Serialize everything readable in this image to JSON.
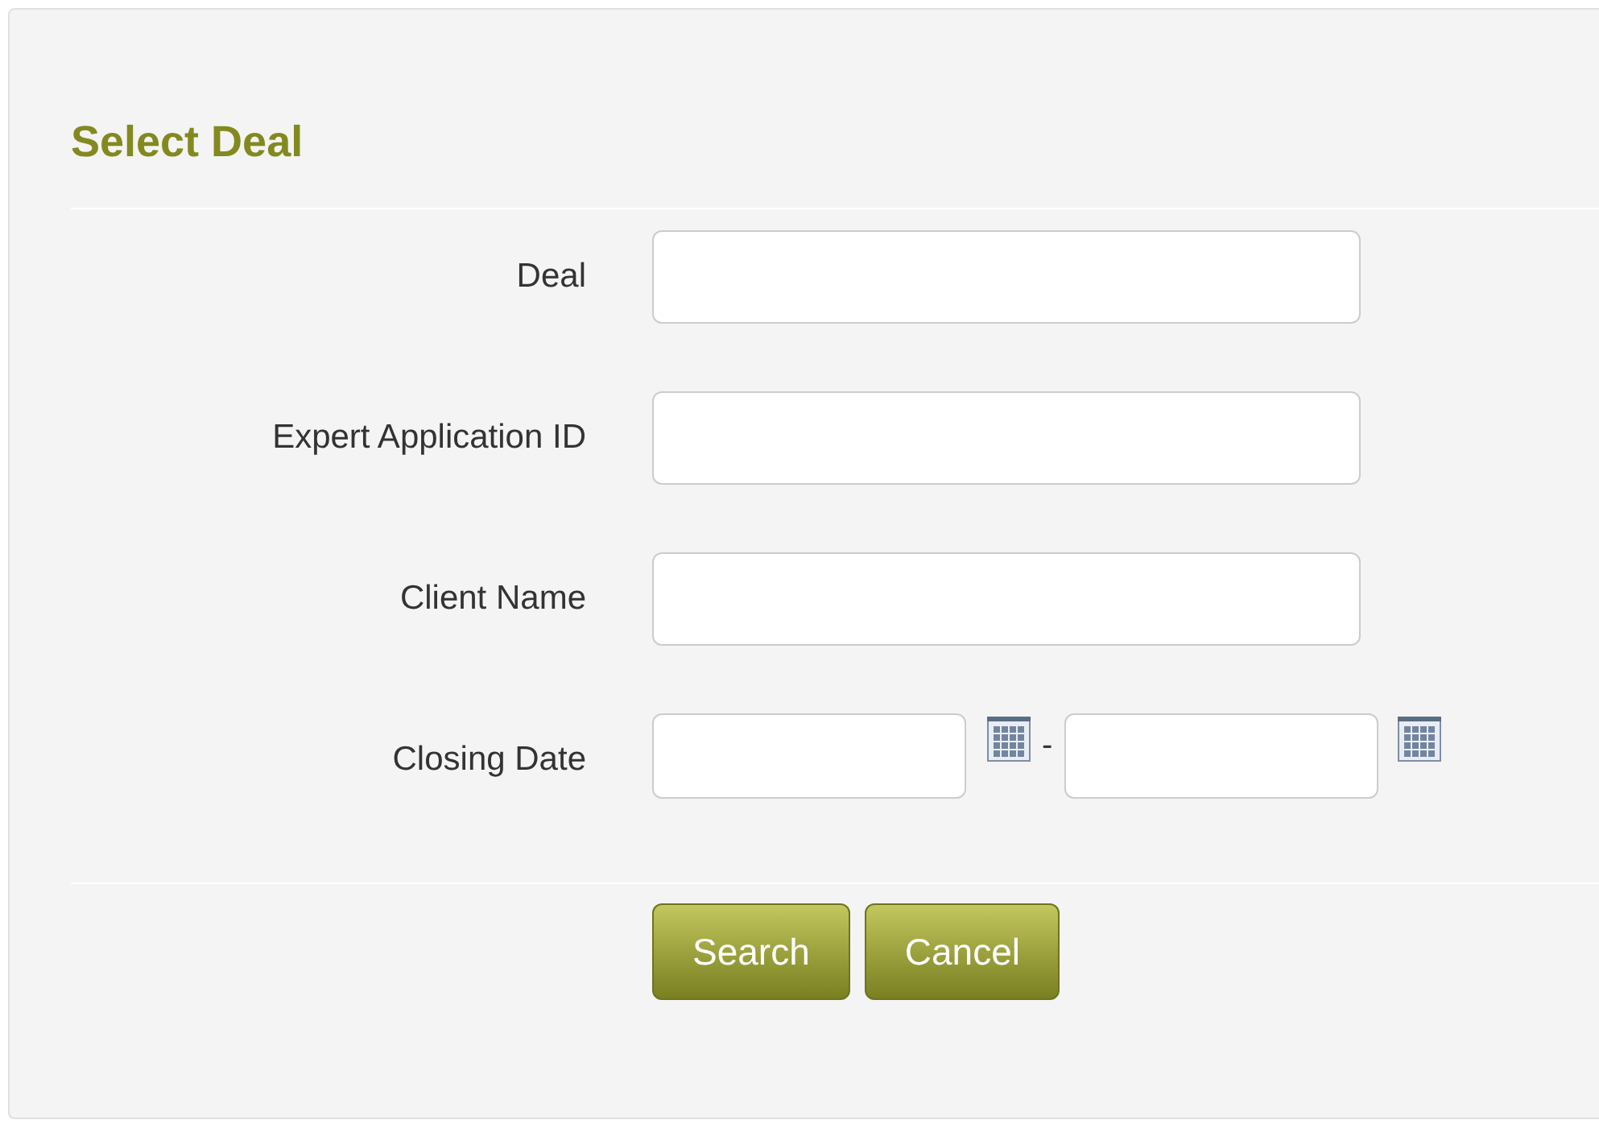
{
  "title": "Select Deal",
  "fields": [
    {
      "kind": "text",
      "label": "Deal"
    },
    {
      "kind": "text",
      "label": "Expert Application ID"
    },
    {
      "kind": "text",
      "label": "Client Name"
    },
    {
      "kind": "daterange",
      "label": "Closing Date",
      "separator": "-"
    }
  ],
  "buttons": [
    "Search",
    "Cancel"
  ]
}
